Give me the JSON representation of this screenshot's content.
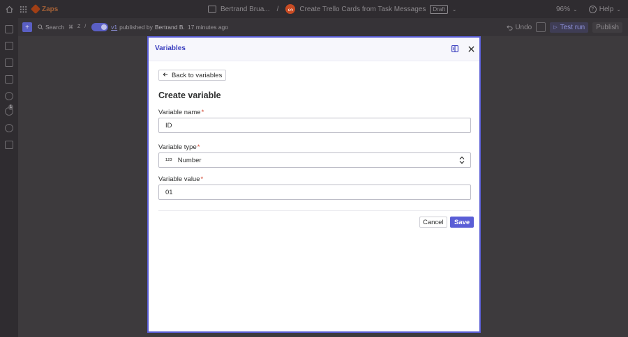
{
  "topbar": {
    "app_name": "Zaps",
    "folder": "Bertrand Brua...",
    "separator": "/",
    "zap_title": "Create Trello Cards from Task Messages",
    "status_badge": "Draft",
    "zoom": "96%",
    "help": "Help"
  },
  "subbar": {
    "search_label": "Search",
    "key1": "⌘",
    "key2": "Z",
    "key3": "/",
    "version": "v1",
    "published_by": "published by",
    "author": "Bertrand B.",
    "time_ago": "17 minutes ago",
    "undo": "Undo",
    "test_run": "Test run",
    "publish": "Publish"
  },
  "sidebar": {
    "badge": "1"
  },
  "modal": {
    "title": "Variables",
    "back_label": "Back to variables",
    "form_title": "Create variable",
    "name_label": "Variable name",
    "name_value": "ID",
    "type_label": "Variable type",
    "type_icon_text": "123",
    "type_value": "Number",
    "value_label": "Variable value",
    "value_value": "01",
    "required_mark": "*",
    "cancel": "Cancel",
    "save": "Save"
  },
  "colors": {
    "accent": "#5a5ed6",
    "brand": "#ff4f00",
    "required": "#d2452f"
  }
}
